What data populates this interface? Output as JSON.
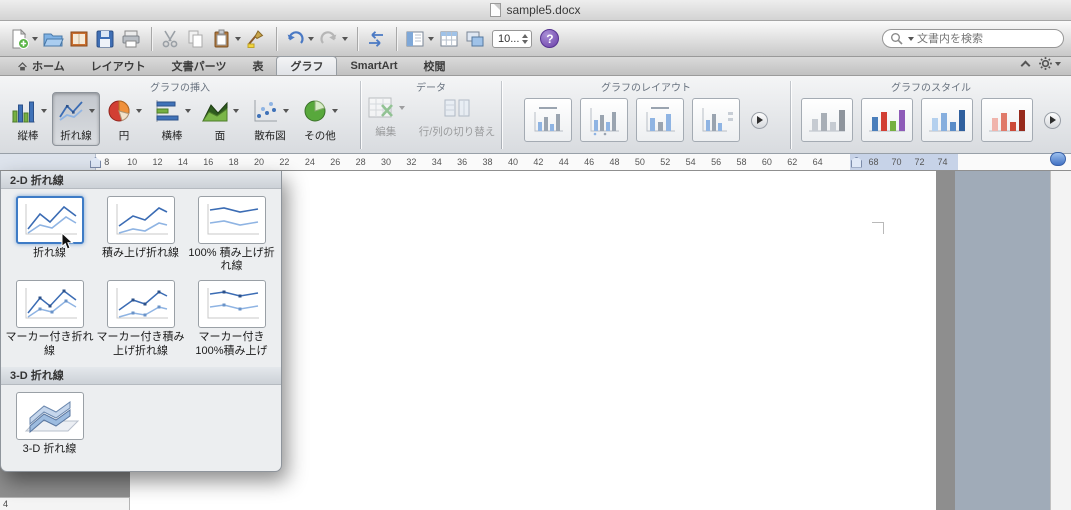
{
  "titlebar": {
    "title": "sample5.docx"
  },
  "toolbar": {
    "zoom_value": "10...",
    "help_label": "?",
    "search_placeholder": "文書内を検索"
  },
  "tabs": {
    "items": [
      {
        "label": "ホーム"
      },
      {
        "label": "レイアウト"
      },
      {
        "label": "文書パーツ"
      },
      {
        "label": "表"
      },
      {
        "label": "グラフ"
      },
      {
        "label": "SmartArt"
      },
      {
        "label": "校閲"
      }
    ]
  },
  "ribbon": {
    "group_insert": {
      "label": "グラフの挿入",
      "buttons": [
        {
          "label": "縦棒"
        },
        {
          "label": "折れ線"
        },
        {
          "label": "円"
        },
        {
          "label": "横棒"
        },
        {
          "label": "面"
        },
        {
          "label": "散布図"
        },
        {
          "label": "その他"
        }
      ]
    },
    "group_data": {
      "label": "データ",
      "buttons": [
        {
          "label": "編集"
        },
        {
          "label": "行/列の切り替え"
        }
      ]
    },
    "group_layout": {
      "label": "グラフのレイアウト"
    },
    "group_style": {
      "label": "グラフのスタイル"
    }
  },
  "ruler": {
    "numbers_left": [
      "8",
      "10",
      "12",
      "14",
      "16",
      "18",
      "20",
      "22",
      "24",
      "26",
      "28",
      "30",
      "32",
      "34",
      "36",
      "38",
      "40",
      "42",
      "44",
      "46",
      "48",
      "50",
      "52",
      "54",
      "56",
      "58",
      "60",
      "62",
      "64"
    ],
    "numbers_right": [
      "68",
      "70",
      "72",
      "74"
    ]
  },
  "menu": {
    "section_2d": {
      "title": "2-D 折れ線"
    },
    "section_3d": {
      "title": "3-D 折れ線"
    },
    "items": [
      {
        "label": "折れ線",
        "selected": true
      },
      {
        "label": "積み上げ折れ線"
      },
      {
        "label": "100% 積み上げ折れ線"
      },
      {
        "label": "マーカー付き折れ線"
      },
      {
        "label": "マーカー付き積み上げ折れ線"
      },
      {
        "label": "マーカー付き100%積み上げ"
      },
      {
        "label": "3-D 折れ線"
      }
    ]
  },
  "misc": {
    "vruler_number": "4"
  },
  "colors": {
    "selection_blue": "#3e7bc6",
    "document_bg": "#8e8e8e",
    "right_panel": "#a0abb8",
    "ruler_margin": "#c7d3e8"
  }
}
